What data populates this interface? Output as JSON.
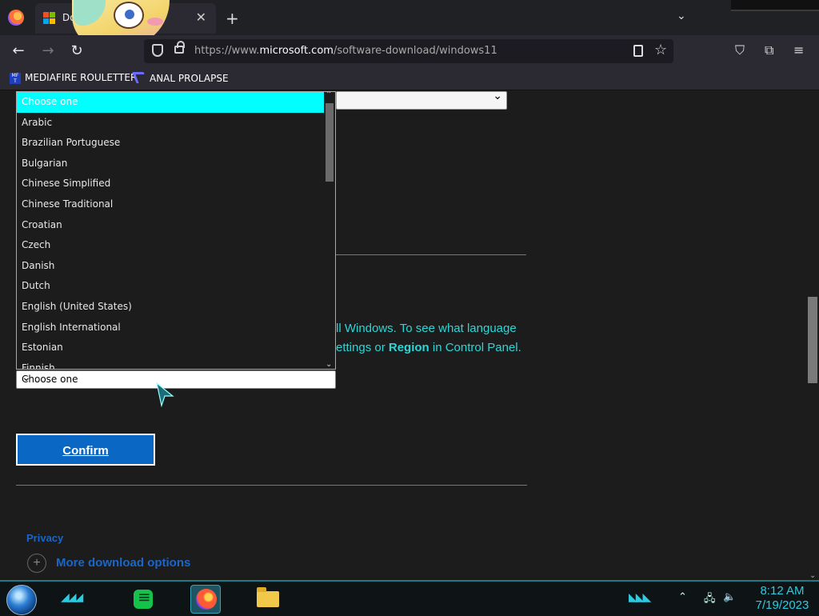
{
  "browser": {
    "tab_title": "Do",
    "tab_close": "✕",
    "new_tab": "+",
    "url_prefix": "https://www.",
    "url_domain": "microsoft.com",
    "url_path": "/software-download/windows11"
  },
  "bookmarks": [
    {
      "label": "MEDIAFIRE ROULETTER",
      "icon": "mediafire-icon",
      "icon_text": "MF T"
    },
    {
      "label": "ANAL PROLAPSE",
      "icon": "sigma-icon"
    }
  ],
  "page": {
    "edition_select_value": "",
    "para_line1_tail": "ll Windows. To see what language",
    "para_line2_head": "ettings or ",
    "para_line2_bold": "Region",
    "para_line2_tail": " in Control Panel.",
    "language_select_value": "Choose one",
    "confirm_label": "Confirm",
    "privacy_label": "Privacy",
    "more_download_label": "More download options"
  },
  "dropdown": {
    "options": [
      "Choose one",
      "Arabic",
      "Brazilian Portuguese",
      "Bulgarian",
      "Chinese Simplified",
      "Chinese Traditional",
      "Croatian",
      "Czech",
      "Danish",
      "Dutch",
      "English (United States)",
      "English International",
      "Estonian",
      "Finnish"
    ],
    "selected_index": 0
  },
  "taskbar": {
    "time": "8:12 AM",
    "date": "7/19/2023"
  },
  "colors": {
    "accent_cyan": "#2dd6d6",
    "selected_option": "#00ffff",
    "confirm_bg": "#0a67c4",
    "link_blue": "#1a66c9"
  }
}
